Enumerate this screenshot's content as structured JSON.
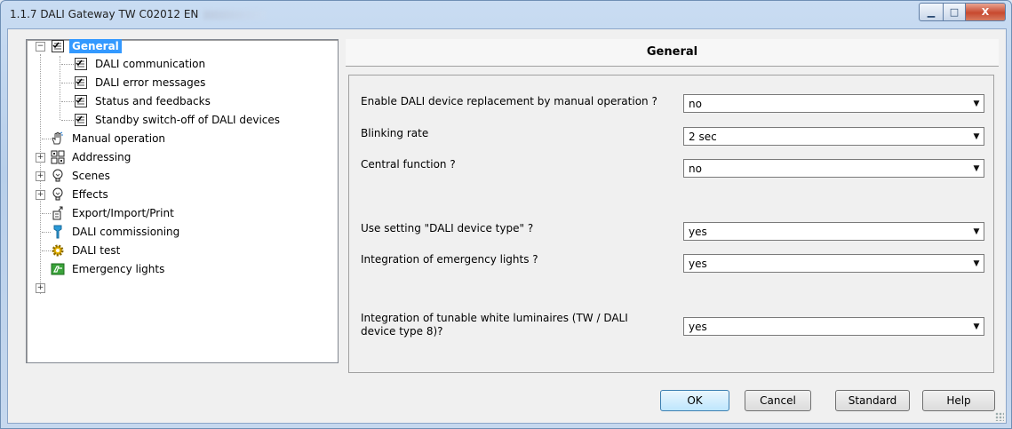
{
  "window": {
    "title": "1.1.7 DALI Gateway TW C02012 EN",
    "minimize": "▁",
    "maximize": "□",
    "close": "X"
  },
  "tree": {
    "items": [
      {
        "label": "General",
        "icon": "checklist-icon",
        "selected": true
      },
      {
        "label": "DALI communication",
        "icon": "checklist-icon"
      },
      {
        "label": "DALI error messages",
        "icon": "checklist-icon"
      },
      {
        "label": "Status and feedbacks",
        "icon": "checklist-icon"
      },
      {
        "label": "Standby switch-off of DALI devices",
        "icon": "checklist-icon"
      },
      {
        "label": "Manual operation",
        "icon": "hand-icon"
      },
      {
        "label": "Addressing",
        "icon": "grid-icon"
      },
      {
        "label": "Scenes",
        "icon": "bulb-icon"
      },
      {
        "label": "Effects",
        "icon": "bulb-icon"
      },
      {
        "label": "Export/Import/Print",
        "icon": "export-icon"
      },
      {
        "label": "DALI commissioning",
        "icon": "wrench-icon"
      },
      {
        "label": "DALI test",
        "icon": "gear-icon"
      },
      {
        "label": "Emergency lights",
        "icon": "emergency-icon"
      }
    ]
  },
  "panel": {
    "title": "General",
    "params": [
      {
        "label": "Enable DALI device replacement by manual operation ?",
        "value": "no"
      },
      {
        "label": "Blinking rate",
        "value": "2 sec"
      },
      {
        "label": "Central function ?",
        "value": "no"
      },
      {
        "label": "Use setting \"DALI device type\" ?",
        "value": "yes"
      },
      {
        "label": "Integration of emergency lights ?",
        "value": "yes"
      },
      {
        "label": "Integration of tunable white luminaires (TW / DALI device type 8)?",
        "value": "yes"
      }
    ]
  },
  "buttons": {
    "ok": "OK",
    "cancel": "Cancel",
    "standard": "Standard",
    "help": "Help"
  },
  "colors": {
    "selection": "#3399ff",
    "default_button": "#bee6fd"
  }
}
